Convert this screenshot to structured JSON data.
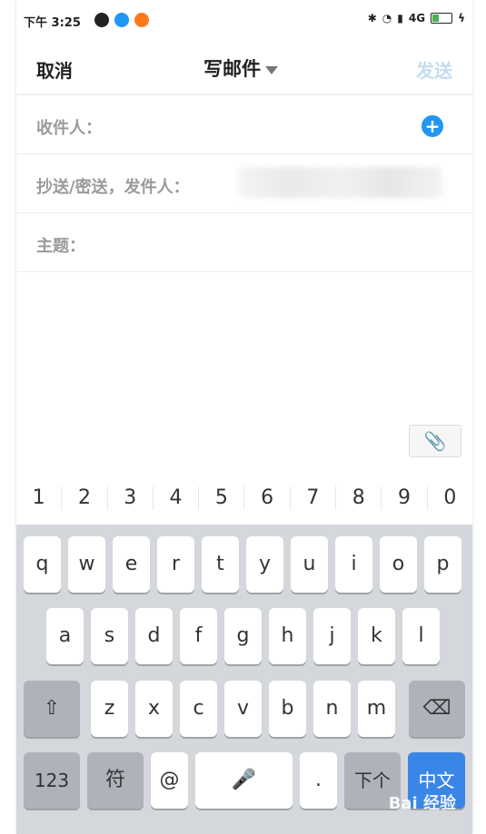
{
  "statusbar": {
    "time": "下午 3:25",
    "network": "4G"
  },
  "header": {
    "cancel": "取消",
    "title": "写邮件",
    "send": "发送"
  },
  "compose": {
    "to_label": "收件人：",
    "cc_label": "抄送/密送，发件人：",
    "subject_label": "主题："
  },
  "numbers": [
    "1",
    "2",
    "3",
    "4",
    "5",
    "6",
    "7",
    "8",
    "9",
    "0"
  ],
  "keyboard": {
    "row1": [
      "q",
      "w",
      "e",
      "r",
      "t",
      "y",
      "u",
      "i",
      "o",
      "p"
    ],
    "row2": [
      "a",
      "s",
      "d",
      "f",
      "g",
      "h",
      "j",
      "k",
      "l"
    ],
    "row3": [
      "z",
      "x",
      "c",
      "v",
      "b",
      "n",
      "m"
    ],
    "bottom": {
      "num": "123",
      "symbol": "符",
      "at": "@",
      "dot": ".",
      "next": "下个",
      "lang": "中文"
    }
  },
  "watermark": "Bai 经验"
}
